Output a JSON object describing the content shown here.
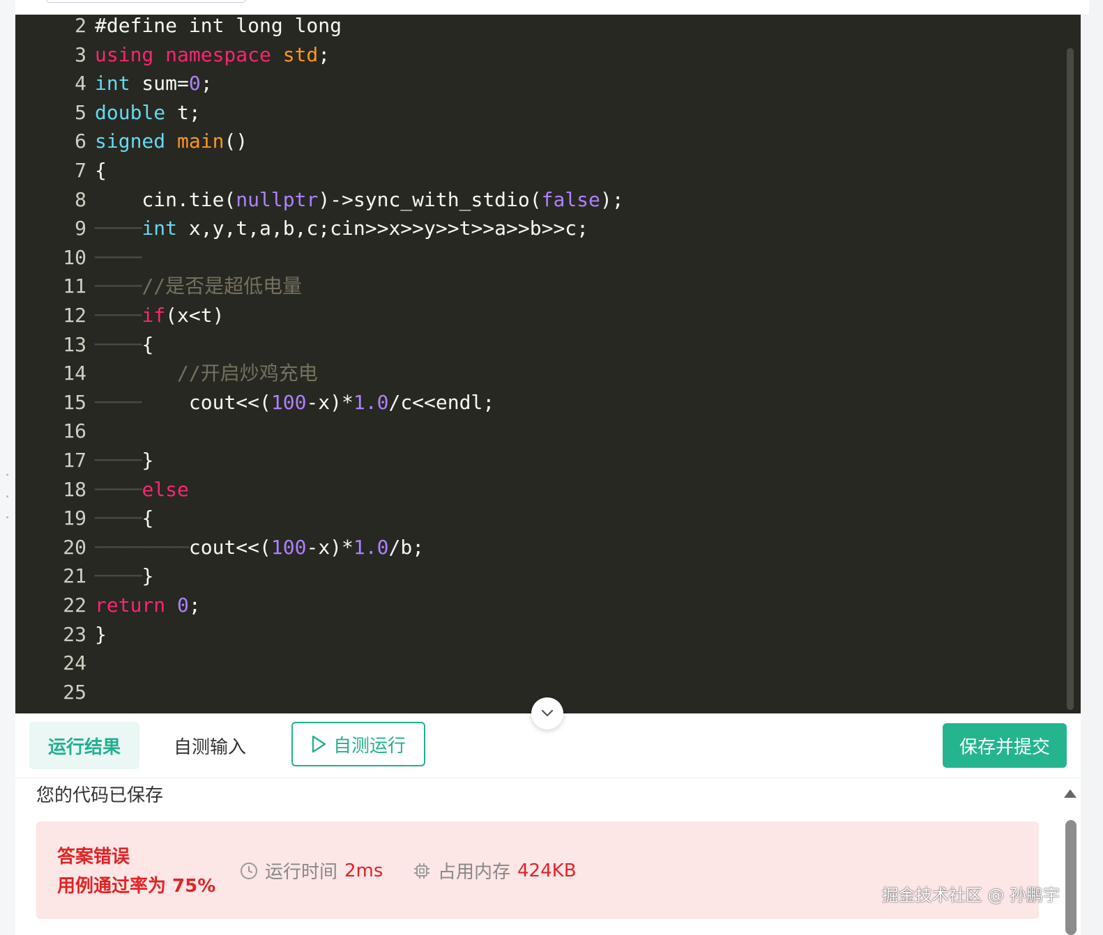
{
  "editor": {
    "lines": [
      {
        "n": "2",
        "code": [
          {
            "t": "#define int long long",
            "c": ""
          }
        ]
      },
      {
        "n": "3",
        "code": [
          {
            "t": "using namespace ",
            "c": "kw"
          },
          {
            "t": "std",
            "c": "fn"
          },
          {
            "t": ";",
            "c": ""
          }
        ]
      },
      {
        "n": "4",
        "code": [
          {
            "t": "int",
            "c": "ty"
          },
          {
            "t": " sum=",
            "c": ""
          },
          {
            "t": "0",
            "c": "nm"
          },
          {
            "t": ";",
            "c": ""
          }
        ]
      },
      {
        "n": "5",
        "code": [
          {
            "t": "double",
            "c": "ty"
          },
          {
            "t": " t;",
            "c": ""
          }
        ]
      },
      {
        "n": "6",
        "code": [
          {
            "t": "signed",
            "c": "ty"
          },
          {
            "t": " ",
            "c": ""
          },
          {
            "t": "main",
            "c": "fn"
          },
          {
            "t": "()",
            "c": ""
          }
        ]
      },
      {
        "n": "7",
        "code": [
          {
            "t": "{",
            "c": ""
          }
        ]
      },
      {
        "n": "8",
        "code": [
          {
            "t": "    cin.tie(",
            "c": ""
          },
          {
            "t": "nullptr",
            "c": "nm"
          },
          {
            "t": ")->sync_with_stdio(",
            "c": ""
          },
          {
            "t": "false",
            "c": "nm"
          },
          {
            "t": ");",
            "c": ""
          }
        ]
      },
      {
        "n": "9",
        "code": [
          {
            "t": "────",
            "c": "ws"
          },
          {
            "t": "int",
            "c": "ty"
          },
          {
            "t": " x,y,t,a,b,c;cin>>x>>y>>t>>a>>b>>c;",
            "c": ""
          }
        ]
      },
      {
        "n": "10",
        "code": [
          {
            "t": "────",
            "c": "ws"
          }
        ]
      },
      {
        "n": "11",
        "code": [
          {
            "t": "────",
            "c": "ws"
          },
          {
            "t": "//是否是超低电量",
            "c": "cm"
          }
        ]
      },
      {
        "n": "12",
        "code": [
          {
            "t": "────",
            "c": "ws"
          },
          {
            "t": "if",
            "c": "kw"
          },
          {
            "t": "(x<t)",
            "c": ""
          }
        ]
      },
      {
        "n": "13",
        "code": [
          {
            "t": "────",
            "c": "ws"
          },
          {
            "t": "{",
            "c": ""
          }
        ]
      },
      {
        "n": "14",
        "code": [
          {
            "t": "       ",
            "c": ""
          },
          {
            "t": "//开启炒鸡充电",
            "c": "cm"
          }
        ]
      },
      {
        "n": "15",
        "code": [
          {
            "t": "────",
            "c": "ws"
          },
          {
            "t": "    cout<<(",
            "c": ""
          },
          {
            "t": "100",
            "c": "nm"
          },
          {
            "t": "-x)*",
            "c": ""
          },
          {
            "t": "1.0",
            "c": "nm"
          },
          {
            "t": "/c<<endl;",
            "c": ""
          }
        ]
      },
      {
        "n": "16",
        "code": []
      },
      {
        "n": "17",
        "code": [
          {
            "t": "────",
            "c": "ws"
          },
          {
            "t": "}",
            "c": ""
          }
        ]
      },
      {
        "n": "18",
        "code": [
          {
            "t": "────",
            "c": "ws"
          },
          {
            "t": "else",
            "c": "kw"
          }
        ]
      },
      {
        "n": "19",
        "code": [
          {
            "t": "────",
            "c": "ws"
          },
          {
            "t": "{",
            "c": ""
          }
        ]
      },
      {
        "n": "20",
        "code": [
          {
            "t": "────",
            "c": "ws"
          },
          {
            "t": "────",
            "c": "ws"
          },
          {
            "t": "cout<<(",
            "c": ""
          },
          {
            "t": "100",
            "c": "nm"
          },
          {
            "t": "-x)*",
            "c": ""
          },
          {
            "t": "1.0",
            "c": "nm"
          },
          {
            "t": "/b;",
            "c": ""
          }
        ]
      },
      {
        "n": "21",
        "code": [
          {
            "t": "────",
            "c": "ws"
          },
          {
            "t": "}",
            "c": ""
          }
        ]
      },
      {
        "n": "22",
        "code": [
          {
            "t": "return ",
            "c": "kw"
          },
          {
            "t": "0",
            "c": "nm"
          },
          {
            "t": ";",
            "c": ""
          }
        ]
      },
      {
        "n": "23",
        "code": [
          {
            "t": "}",
            "c": ""
          }
        ]
      },
      {
        "n": "24",
        "code": []
      },
      {
        "n": "25",
        "code": []
      }
    ]
  },
  "toolbar": {
    "tab_result": "运行结果",
    "tab_input": "自测输入",
    "run_button": "自测运行",
    "submit_button": "保存并提交"
  },
  "result": {
    "saved_message": "您的代码已保存",
    "status_title": "答案错误",
    "pass_rate": "用例通过率为 75%",
    "runtime_label": "运行时间",
    "runtime_value": "2ms",
    "memory_label": "占用内存",
    "memory_value": "424KB"
  },
  "watermark": "掘金技术社区 @ 孙鹏宇",
  "colors": {
    "accent": "#24b58f",
    "error": "#e02424",
    "editor_bg": "#272822"
  }
}
